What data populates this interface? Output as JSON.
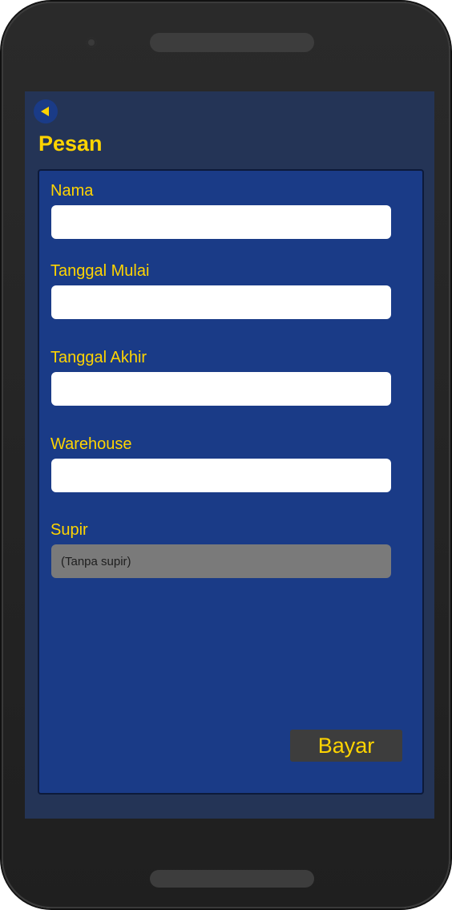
{
  "page": {
    "title": "Pesan",
    "back_icon": "back-arrow-icon"
  },
  "form": {
    "fields": [
      {
        "label": "Nama",
        "value": "",
        "placeholder": ""
      },
      {
        "label": "Tanggal Mulai",
        "value": "",
        "placeholder": ""
      },
      {
        "label": "Tanggal Akhir",
        "value": "",
        "placeholder": ""
      },
      {
        "label": "Warehouse",
        "value": "",
        "placeholder": ""
      }
    ],
    "driver": {
      "label": "Supir",
      "selected": "(Tanpa supir)"
    },
    "submit_label": "Bayar"
  },
  "colors": {
    "accent": "#ffd400",
    "screen_bg": "#243456",
    "card_bg": "#1a3b87",
    "button_bg": "#3d3d3d",
    "select_bg": "#7a7a7a"
  }
}
